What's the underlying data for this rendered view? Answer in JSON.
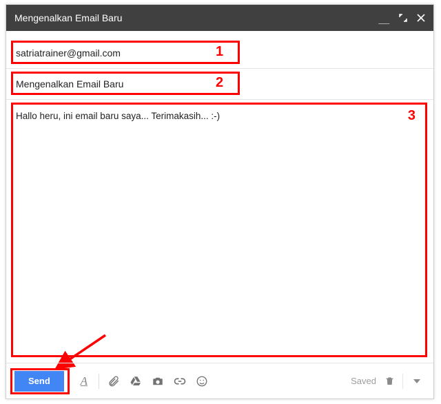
{
  "window": {
    "title": "Mengenalkan Email Baru"
  },
  "compose": {
    "to": "satriatrainer@gmail.com",
    "subject": "Mengenalkan Email Baru",
    "body": "Hallo heru, ini email baru saya... Terimakasih... :-)"
  },
  "footer": {
    "send_label": "Send",
    "saved_label": "Saved"
  },
  "annotations": {
    "n1": "1",
    "n2": "2",
    "n3": "3"
  },
  "colors": {
    "accent": "#4285f4",
    "annotation": "#ff0000",
    "titlebar": "#404040"
  }
}
